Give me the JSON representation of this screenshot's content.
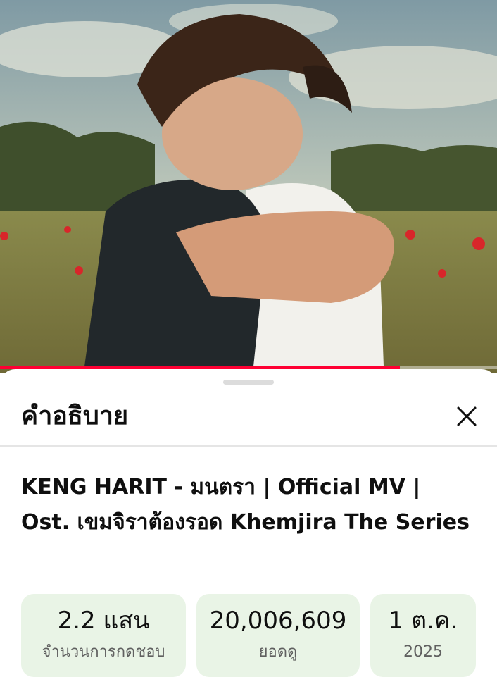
{
  "video": {
    "progress_fraction": 0.805
  },
  "sheet": {
    "title": "คำอธิบาย",
    "close_icon": "close-icon"
  },
  "description": {
    "title": "KENG HARIT - มนตรา | Official MV | Ost. เขมจิราต้องรอด Khemjira The Series"
  },
  "stats": {
    "likes": {
      "value": "2.2 แสน",
      "label": "จำนวนการกดชอบ"
    },
    "views": {
      "value": "20,006,609",
      "label": "ยอดดู"
    },
    "date": {
      "value": "1 ต.ค.",
      "label": "2025"
    }
  },
  "colors": {
    "progress": "#ff0033",
    "stat_background": "#e9f4e6"
  }
}
